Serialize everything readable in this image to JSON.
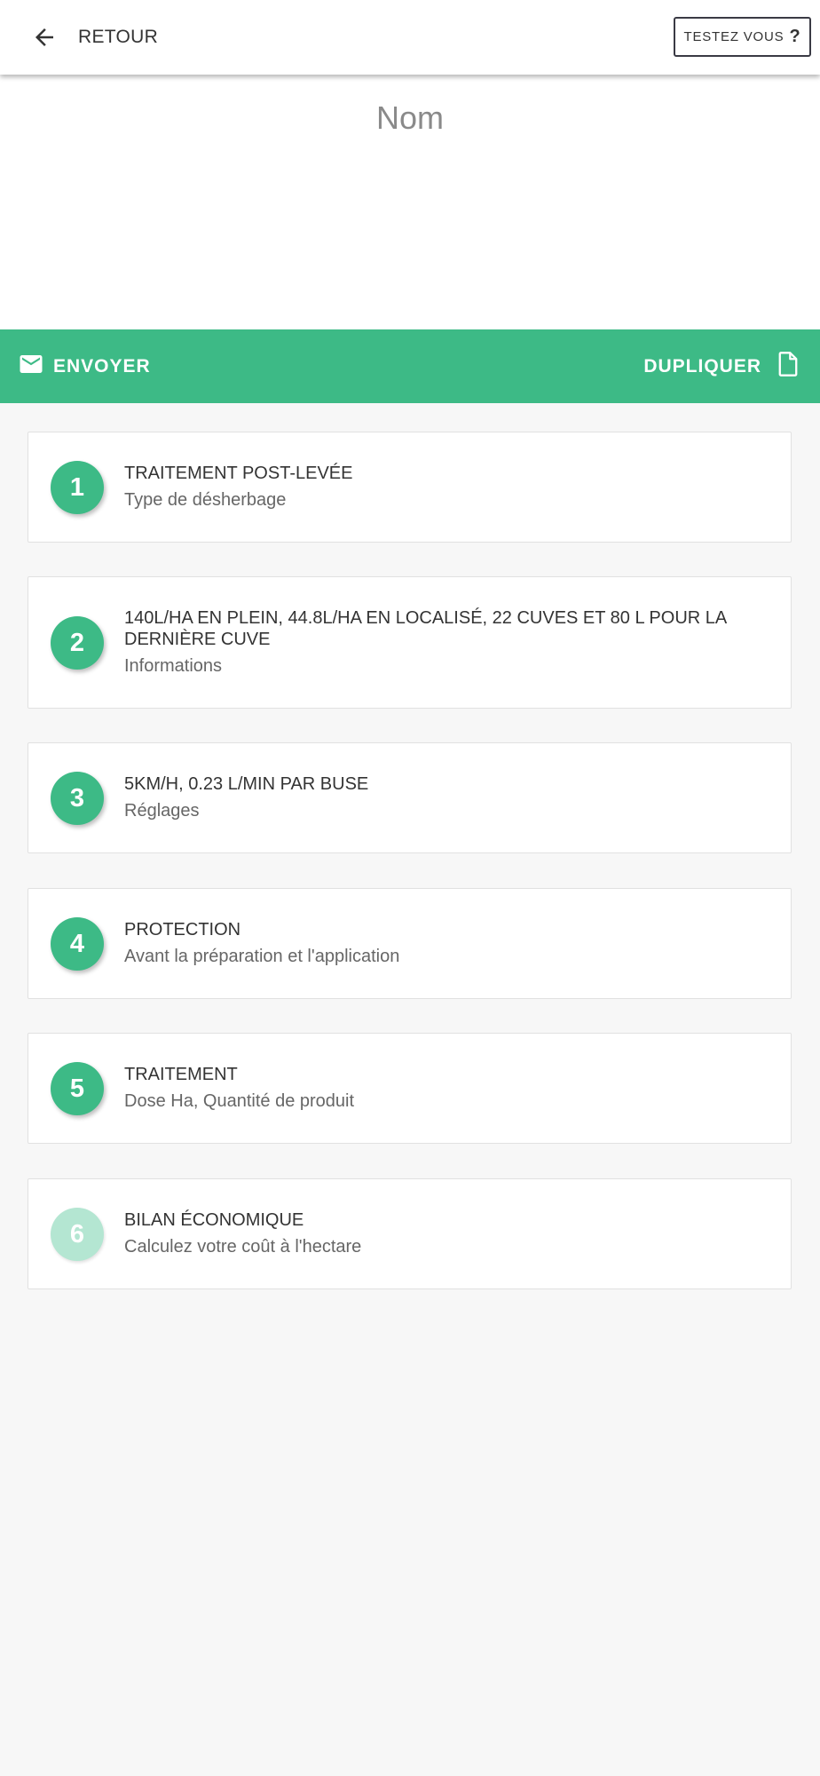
{
  "topbar": {
    "back_label": "RETOUR",
    "test_label": "TESTEZ VOUS",
    "test_mark": "?"
  },
  "header": {
    "title": "Nom"
  },
  "actions": {
    "send_label": "ENVOYER",
    "duplicate_label": "DUPLIQUER"
  },
  "colors": {
    "accent": "#3dba86",
    "accent_disabled": "#b4e6d2"
  },
  "steps": [
    {
      "number": "1",
      "title": "TRAITEMENT POST-LEVÉE",
      "subtitle": "Type de désherbage"
    },
    {
      "number": "2",
      "title": "140L/HA EN PLEIN, 44.8L/HA EN LOCALISÉ, 22 CUVES ET 80 L POUR LA DERNIÈRE CUVE",
      "subtitle": "Informations"
    },
    {
      "number": "3",
      "title": "5KM/H, 0.23 L/MIN PAR BUSE",
      "subtitle": "Réglages"
    },
    {
      "number": "4",
      "title": "PROTECTION",
      "subtitle": "Avant la préparation et l'application"
    },
    {
      "number": "5",
      "title": "TRAITEMENT",
      "subtitle": "Dose Ha, Quantité de produit"
    },
    {
      "number": "6",
      "title": "BILAN ÉCONOMIQUE",
      "subtitle": "Calculez votre coût à l'hectare"
    }
  ]
}
